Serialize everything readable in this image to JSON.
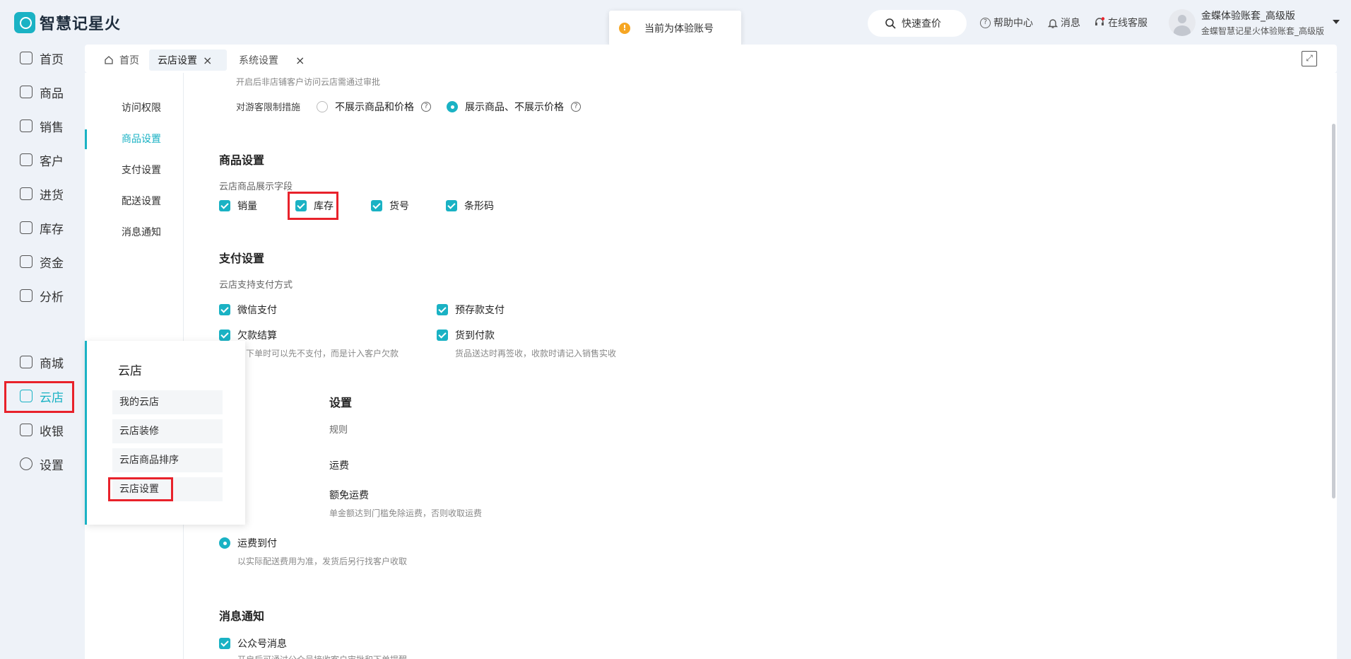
{
  "app": {
    "logo_text": "智慧记星火"
  },
  "toast": {
    "text": "当前为体验账号"
  },
  "header": {
    "search_label": "快速查价",
    "help_label": "帮助中心",
    "messages_label": "消息",
    "online_service_label": "在线客服",
    "user_name": "金蝶体验账套_高级版",
    "user_subtitle": "金蝶智慧记星火体验账套_高级版"
  },
  "leftnav": {
    "items": [
      {
        "label": "首页",
        "icon": "home-icon"
      },
      {
        "label": "商品",
        "icon": "bag-icon"
      },
      {
        "label": "销售",
        "icon": "clipboard-icon"
      },
      {
        "label": "客户",
        "icon": "user-icon"
      },
      {
        "label": "进货",
        "icon": "book-icon"
      },
      {
        "label": "库存",
        "icon": "warehouse-icon"
      },
      {
        "label": "资金",
        "icon": "wallet-icon"
      },
      {
        "label": "分析",
        "icon": "chart-icon"
      },
      {
        "label": "商城",
        "icon": "mall-icon"
      },
      {
        "label": "云店",
        "icon": "store-icon",
        "active": true
      },
      {
        "label": "收银",
        "icon": "cashier-icon"
      },
      {
        "label": "设置",
        "icon": "gear-icon"
      }
    ]
  },
  "tabs": [
    {
      "label": "首页"
    },
    {
      "label": "云店设置",
      "active": true
    },
    {
      "label": "系统设置"
    }
  ],
  "subnav": [
    "访问权限",
    "商品设置",
    "支付设置",
    "配送设置",
    "消息通知"
  ],
  "access": {
    "hint_top": "开启后非店铺客户访问云店需通过审批",
    "guest_label": "对游客限制措施",
    "option_hide": "不展示商品和价格",
    "option_show": "展示商品、不展示价格"
  },
  "goods": {
    "title": "商品设置",
    "fields_label": "云店商品展示字段",
    "fields": [
      "销量",
      "库存",
      "货号",
      "条形码"
    ]
  },
  "payment": {
    "title": "支付设置",
    "methods_label": "云店支持支付方式",
    "wechat": "微信支付",
    "prepaid": "预存款支付",
    "credit": "欠款结算",
    "credit_hint": "户下单时可以先不支付，而是计入客户欠款",
    "cod": "货到付款",
    "cod_hint": "货品送达时再签收，收款时请记入销售实收"
  },
  "delivery": {
    "title_fragment": "设置",
    "rule_fragment": "规则",
    "free_fragment": "运费",
    "threshold_fragment": "额免运费",
    "threshold_hint": "单金额达到门槛免除运费，否则收取运费",
    "collect": "运费到付",
    "collect_hint": "以实际配送费用为准，发货后另行找客户收取"
  },
  "notice": {
    "title": "消息通知",
    "official_account": "公众号消息",
    "official_hint": "开启后可通过公众号接收客户审批和下单提醒"
  },
  "flyout": {
    "title": "云店",
    "items": [
      "我的云店",
      "云店装修",
      "云店商品排序",
      "云店设置"
    ]
  }
}
